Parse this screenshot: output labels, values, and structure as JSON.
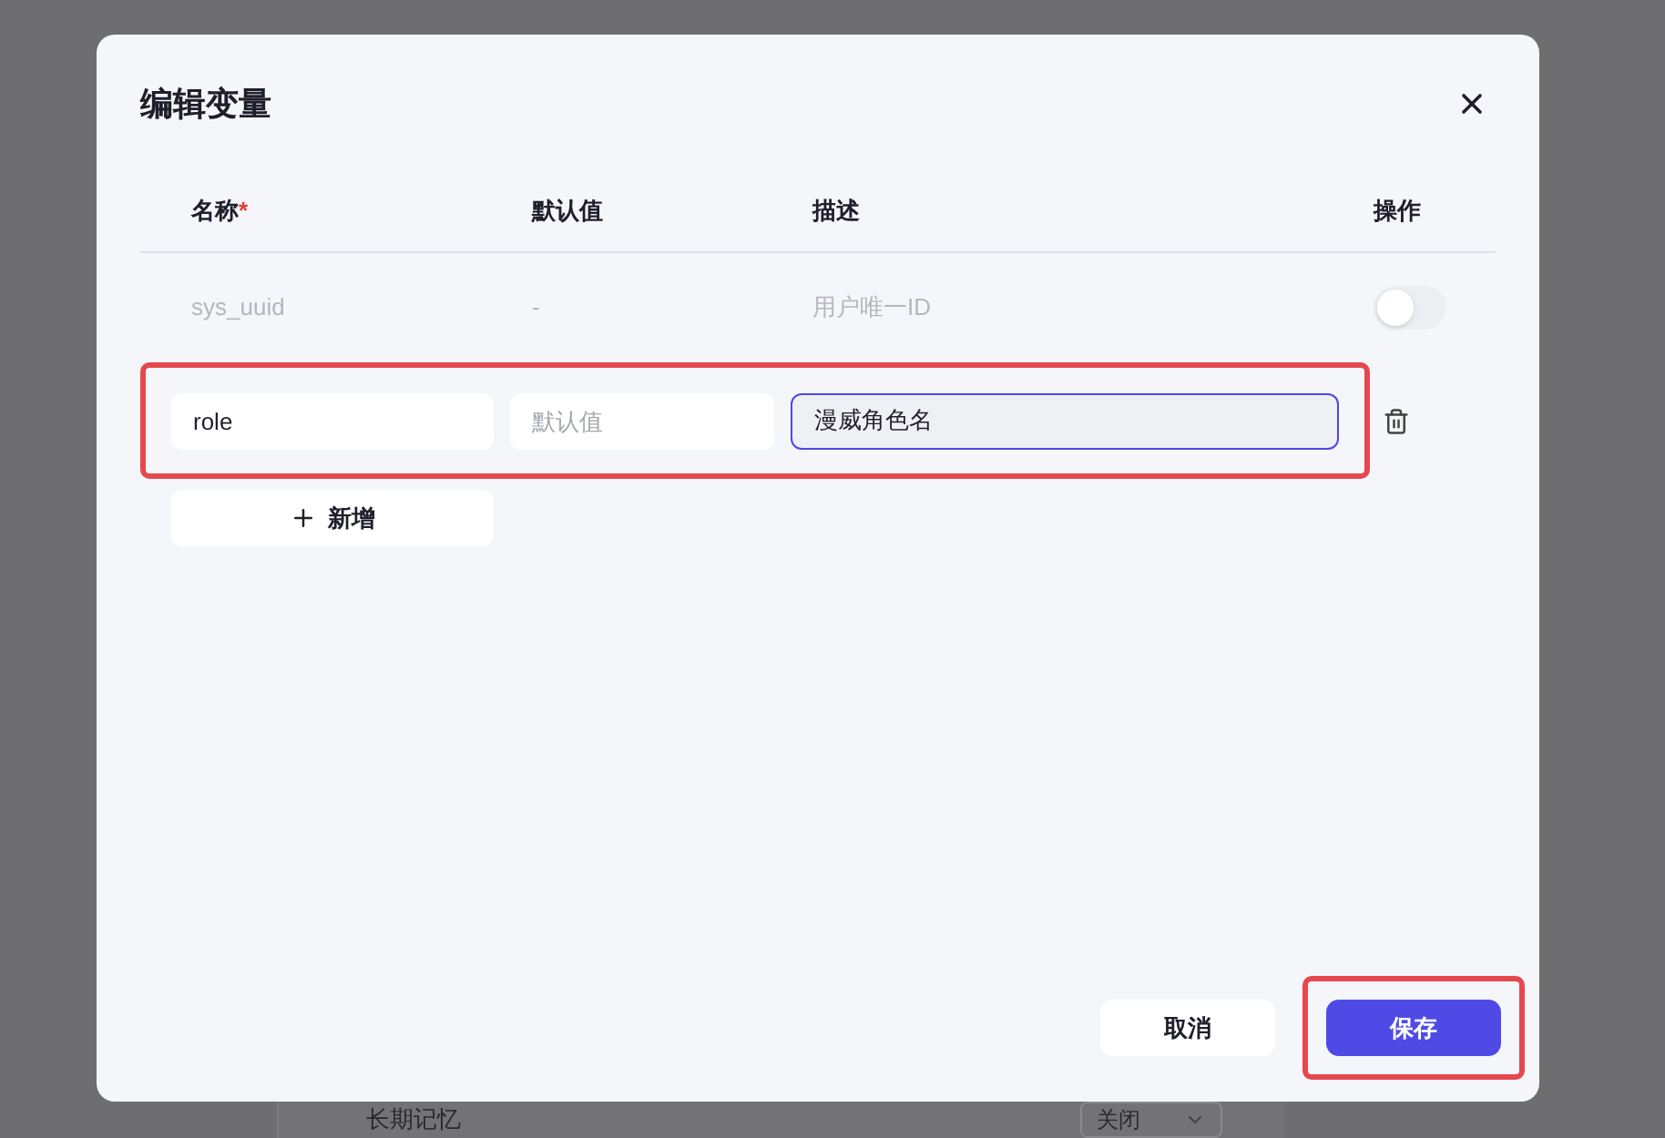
{
  "background": {
    "section_label": "长期记忆",
    "select_value": "关闭"
  },
  "dialog": {
    "title": "编辑变量",
    "columns": [
      {
        "label": "名称",
        "required_mark": "*"
      },
      {
        "label": "默认值"
      },
      {
        "label": "描述"
      },
      {
        "label": "操作"
      }
    ],
    "rows": [
      {
        "kind": "system",
        "name": "sys_uuid",
        "default": "-",
        "description": "用户唯一ID",
        "on": false,
        "highlighted": false
      },
      {
        "kind": "custom",
        "name": "role",
        "default_placeholder": "默认值",
        "description": "漫威角色名",
        "highlighted": true
      }
    ],
    "add_button": "新增",
    "buttons": [
      {
        "label": "取消",
        "kind": "secondary",
        "highlighted": false
      },
      {
        "label": "保存",
        "kind": "primary",
        "highlighted": true
      }
    ]
  }
}
